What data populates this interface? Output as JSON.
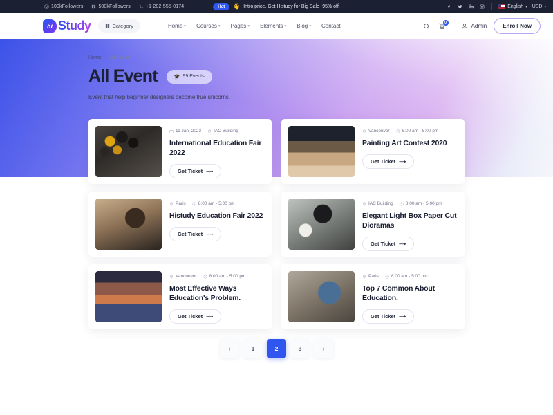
{
  "topbar": {
    "left": [
      {
        "icon": "instagram-icon",
        "label": "100kFollowers"
      },
      {
        "icon": "facebook-icon",
        "label": "500kFollowers"
      },
      {
        "icon": "phone-icon",
        "label": "+1-202-555-0174"
      }
    ],
    "hot_label": "Hot",
    "promo": "Intro price. Get Histudy for Big Sale -95% off.",
    "socials": [
      "facebook-icon",
      "twitter-icon",
      "linkedin-icon",
      "instagram-icon"
    ],
    "language": "English",
    "currency": "USD"
  },
  "header": {
    "logo_mark": "hi",
    "logo_text": "Study",
    "category_label": "Category",
    "nav": [
      {
        "label": "Home",
        "has_dropdown": true
      },
      {
        "label": "Courses",
        "has_dropdown": true
      },
      {
        "label": "Pages",
        "has_dropdown": true
      },
      {
        "label": "Elements",
        "has_dropdown": true
      },
      {
        "label": "Blog",
        "has_dropdown": true
      },
      {
        "label": "Contact",
        "has_dropdown": false
      }
    ],
    "cart_count": "0",
    "account_label": "Admin",
    "enroll_label": "Enroll Now"
  },
  "hero": {
    "breadcrumb_home": "Home",
    "breadcrumb_sep": "›",
    "breadcrumb_current": "All Event",
    "title": "All Event",
    "badge_emoji": "🎓",
    "badge_label": "99 Events",
    "subtitle": "Event that help beginner designers become true unicorns."
  },
  "events": [
    {
      "date": "11 Jan, 2023",
      "date_icon": "calendar-icon",
      "location": "IAC Building",
      "location_icon": "location-icon",
      "title": "International Education Fair 2022",
      "button": "Get Ticket",
      "thumb_class": "t1"
    },
    {
      "date": "Vancouver",
      "date_icon": "location-icon",
      "location": "8:00 am - 5:00 pm",
      "location_icon": "clock-icon",
      "title": "Painting Art Contest 2020",
      "button": "Get Ticket",
      "thumb_class": "t2"
    },
    {
      "date": "Paris",
      "date_icon": "location-icon",
      "location": "8:00 am - 5:00 pm",
      "location_icon": "clock-icon",
      "title": "Histudy Education Fair 2022",
      "button": "Get Ticket",
      "thumb_class": "t3"
    },
    {
      "date": "IAC Building",
      "date_icon": "location-icon",
      "location": "8:00 am - 5:00 pm",
      "location_icon": "clock-icon",
      "title": "Elegant Light Box Paper Cut Dioramas",
      "button": "Get Ticket",
      "thumb_class": "t4"
    },
    {
      "date": "Vancouver",
      "date_icon": "location-icon",
      "location": "8:00 am - 5:00 pm",
      "location_icon": "clock-icon",
      "title": "Most Effective Ways Education's Problem.",
      "button": "Get Ticket",
      "thumb_class": "t5"
    },
    {
      "date": "Paris",
      "date_icon": "location-icon",
      "location": "8:00 am - 5:00 pm",
      "location_icon": "clock-icon",
      "title": "Top 7 Common About Education.",
      "button": "Get Ticket",
      "thumb_class": "t6"
    }
  ],
  "pagination": {
    "prev": "‹",
    "next": "›",
    "pages": [
      "1",
      "2",
      "3"
    ],
    "active": "2"
  },
  "colors": {
    "accent": "#2f57ef",
    "topbar_bg": "#1b2032",
    "title": "#1c2033"
  }
}
